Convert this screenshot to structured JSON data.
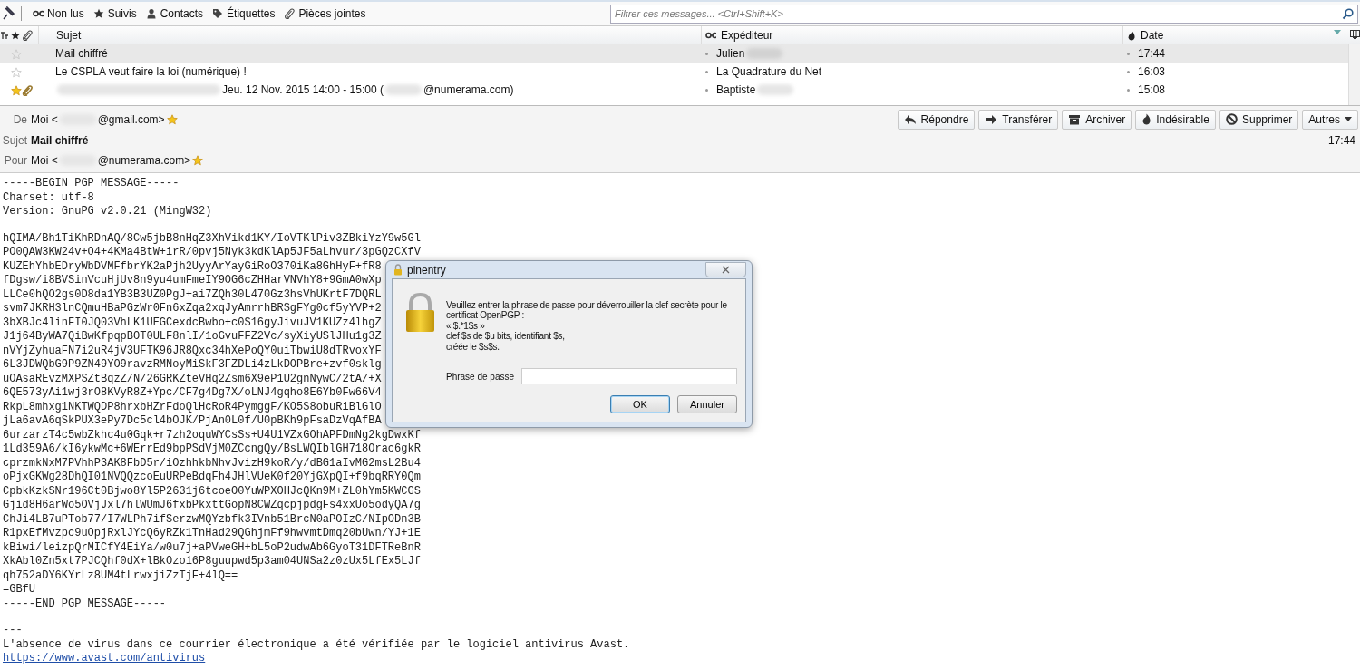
{
  "filter_bar": {
    "buttons": [
      "Non lus",
      "Suivis",
      "Contacts",
      "Étiquettes",
      "Pièces jointes"
    ],
    "search": {
      "placeholder": "Filtrer ces messages... <Ctrl+Shift+K>"
    }
  },
  "message_list": {
    "columns": [
      "Sujet",
      "Expéditeur",
      "Date"
    ],
    "rows": [
      {
        "selected": true,
        "starred": false,
        "attachment": false,
        "subject": [
          {
            "kind": "text",
            "text": "Mail chiffré"
          }
        ],
        "sender": [
          {
            "kind": "text",
            "text": "Julien"
          },
          {
            "kind": "redacted"
          }
        ],
        "date": "17:44"
      },
      {
        "selected": false,
        "starred": false,
        "attachment": false,
        "subject": [
          {
            "kind": "text",
            "text": "Le CSPLA veut faire la loi (numérique) !"
          }
        ],
        "sender": [
          {
            "kind": "text",
            "text": "La Quadrature du Net"
          }
        ],
        "date": "16:03"
      },
      {
        "selected": false,
        "starred": true,
        "attachment": true,
        "subject": [
          {
            "kind": "redacted"
          },
          {
            "kind": "text",
            "text": "Jeu. 12 Nov. 2015 14:00 - 15:00 ("
          },
          {
            "kind": "redacted"
          },
          {
            "kind": "text",
            "text": "@numerama.com)"
          }
        ],
        "sender": [
          {
            "kind": "text",
            "text": "Baptiste"
          },
          {
            "kind": "redacted"
          }
        ],
        "date": "15:08"
      }
    ]
  },
  "header": {
    "from": {
      "label": "De",
      "address": [
        {
          "kind": "text",
          "text": "Moi <"
        },
        {
          "kind": "redacted"
        },
        {
          "kind": "text",
          "text": "@gmail.com>"
        }
      ],
      "starred": true
    },
    "subject": {
      "label": "Sujet",
      "text": "Mail chiffré"
    },
    "date": "17:44",
    "to": {
      "label": "Pour",
      "address": [
        {
          "kind": "text",
          "text": "Moi <"
        },
        {
          "kind": "redacted"
        },
        {
          "kind": "text",
          "text": "@numerama.com>"
        }
      ],
      "starred": true
    },
    "actions": [
      "Répondre",
      "Transférer",
      "Archiver",
      "Indésirable",
      "Supprimer",
      "Autres"
    ]
  },
  "body": {
    "paragraphs": [
      [
        "-----BEGIN PGP MESSAGE-----",
        "Charset: utf-8",
        "Version: GnuPG v2.0.21 (MingW32)"
      ],
      [
        "hQIMA/Bh1TiKhRDnAQ/8Cw5jbB8nHqZ3XhVikd1KY/IoVTKlPiv3ZBkiYzY9w5Gl",
        "PO0QAW3KW24v+O4+4KMa4BtW+irR/0pvj5Nyk3kdKlAp5JF5aLhvur/3pGQzCXfV",
        "KUZEhYhbEDryWbDVMFfbrYK2aPjh2UyyArYayGiRoO370iKa8GhHyF+fR8",
        "fDgsw/i8BVSinVcuHjUv8n9yu4umFmeIY9OG6cZHHarVNVhY8+9GmA0wXp",
        "LLCe0hQO2gs0D8da1YB3B3UZ0PgJ+ai7ZQh30L470Gz3hsVhUKrtF7DQRL",
        "svm7JKRH3lnCQmuHBaPGzWr0Fn6xZqa2xqJyAmrrhBRSgFYg0cf5yYVP+2",
        "3bXBJc4linFI0JQ03VhLK1UEGCexdcBwbo+c0S16gyJivuJV1KUZz4lhgZ",
        "J1j64ByWA7QiBwKfpqpBOT0ULF8nlI/1oGvuFFZ2Vc/syXiyUSlJHu1g3Z",
        "nVYjZyhuaFN7i2uR4jV3UFTK96JR8Qxc34hXePoQY0uiTbwiU8dTRvoxYF",
        "6L3JDWQbG9P9ZN49YO9ravzRMNoyMiSkF3FZDLi4zLkDOPBre+zvf0sklg",
        "uOAsaREvzMXPSZtBqzZ/N/26GRKZteVHq2Zsm6X9eP1U2gnNywC/2tA/+X",
        "6QE573yAi1wj3rO8KVyR8Z+Ypc/CF7g4Dg7X/oLNJ4gqho8E6Yb0Fw66V4",
        "RkpL8mhxg1NKTWQDP8hrxbHZrFdoQlHcRoR4PymggF/KO5S8obuRiBlGlO",
        "jLa6avA6qSkPUX3ePy7Dc5cl4bOJK/PjAn0L0f/U0pBKh9pFsaDzVqAfBA",
        "6urzarzT4c5wbZkhc4u0Gqk+r7zh2oquWYCsSs+U4U1VZxGOhAPFDmNg2kgDwxKf",
        "1Ld359A6/kI6ykwMc+6WErrEd9bpPSdVjM0ZCcngQy/BsLWQIblGH718Orac6gkR",
        "cprzmkNxM7PVhhP3AK8FbD5r/iOzhhkbNhvJvizH9koR/y/dBG1aIvMG2msL2Bu4",
        "oPjxGKWg28DhQI01NVQQzcoEuURPeBdqFh4JHlVUeK0f20YjGXpQI+f9bqRRY0Qm",
        "CpbkKzkSNr196Ct0Bjwo8Yl5P2631j6tcoeO0YuWPXOHJcQKn9M+ZL0hYm5KWCGS",
        "Gjid8H6arWo5OVjJxl7hlWUmJ6fxbPkxttGopN8CWZqcpjpdgFs4xxUo5odyQA7g",
        "ChJi4LB7uPTob77/I7WLPh7ifSerzwMQYzbfk3IVnb51BrcN0aPOIzC/NIpODn3B",
        "R1pxEfMvzpc9uOpjRxlJYcQ6yRZk1TnHad29QGhjmFf9hwvmtDmq20bUwn/YJ+1E",
        "kBiwi/leizpQrMICfY4EiYa/w0u7j+aPVweGH+bL5oP2udwAb6GyoT31DFTReBnR",
        "XkAbl0Zn5xt7PJCQhf0dX+lBkOzo16P8guupwd5p3am04UNSa2z0zUx5LfEx5LJf",
        "qh752aDY6KYrLz8UM4tLrwxjiZzTjF+4lQ==",
        "=GBfU",
        "-----END PGP MESSAGE-----"
      ]
    ],
    "signature": {
      "separator": "---",
      "text": "L'absence de virus dans ce courrier électronique a été vérifiée par le logiciel antivirus Avast.",
      "link": "https://www.avast.com/antivirus"
    }
  },
  "dialog": {
    "title": "pinentry",
    "message": [
      "Veuillez entrer la phrase de passe pour déverrouiller la clef secrète pour le",
      "certificat OpenPGP :",
      "« $.*1$s »",
      "clef $s de $u bits, identifiant $s,",
      "créée le $s$s."
    ],
    "field_label": "Phrase de passe",
    "buttons": [
      {
        "label": "OK",
        "default": true
      },
      {
        "label": "Annuler",
        "default": false
      }
    ]
  }
}
